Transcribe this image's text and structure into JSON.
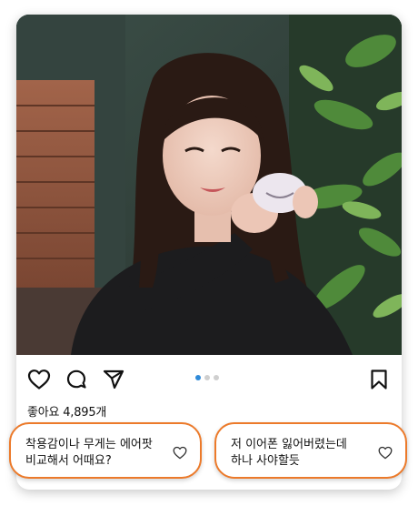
{
  "post": {
    "likes_label": "좋아요 4,895개",
    "carousel": {
      "count": 3,
      "active_index": 0
    }
  },
  "icons": {
    "like": "heart-outline-icon",
    "comment": "comment-bubble-icon",
    "share": "send-paper-plane-icon",
    "save": "bookmark-icon",
    "comment_like": "small-heart-icon"
  },
  "comments": [
    {
      "line1": "착용감이나 무게는 에어팟",
      "line2": "비교해서 어때요?"
    },
    {
      "line1": "저 이어폰 잃어버렸는데",
      "line2": "하나 사야할듯"
    }
  ],
  "colors": {
    "accent_orange": "#ec7a2a",
    "carousel_active": "#2f8ad8",
    "carousel_inactive": "#cfcfcf"
  }
}
